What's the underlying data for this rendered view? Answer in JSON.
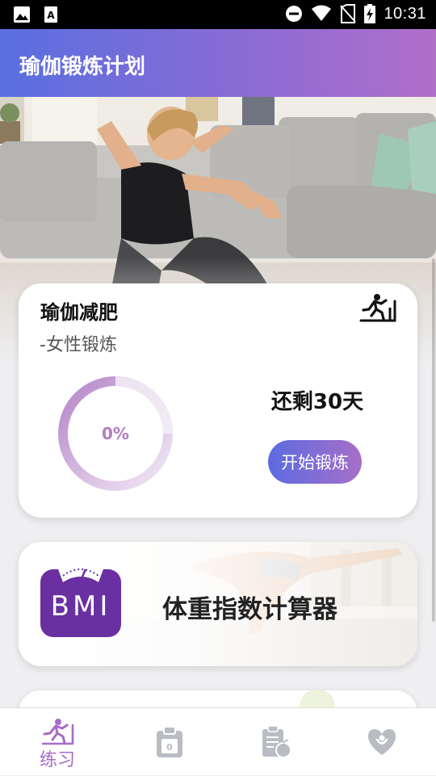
{
  "status_bar": {
    "time": "10:31"
  },
  "app_bar": {
    "title": "瑜伽锻炼计划"
  },
  "plan_card": {
    "title": "瑜伽减肥",
    "subtitle": "-女性锻炼",
    "progress_text": "0%",
    "progress_value": 0,
    "days_left": "还剩30天",
    "start_button": "开始锻炼"
  },
  "bmi_card": {
    "icon_text": "BMI",
    "label": "体重指数计算器"
  },
  "bottom_nav": {
    "items": [
      {
        "label": "练习",
        "icon": "exercise-icon",
        "active": true
      },
      {
        "label": "",
        "icon": "clipboard-icon",
        "active": false
      },
      {
        "label": "",
        "icon": "diet-plan-icon",
        "active": false
      },
      {
        "label": "",
        "icon": "heart-care-icon",
        "active": false
      }
    ]
  },
  "colors": {
    "accent_start": "#5a6fe0",
    "accent_end": "#b06fc9",
    "progress_text": "#b07cc0"
  }
}
